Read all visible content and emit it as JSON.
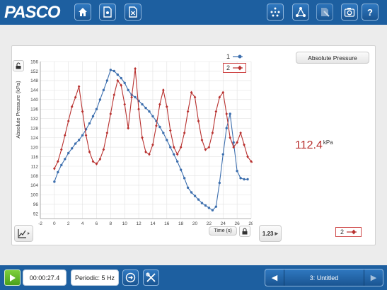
{
  "app": {
    "logo_text": "PASCO"
  },
  "toolbar": {
    "left_buttons": [
      "home-icon",
      "file-icon",
      "close-file-icon"
    ],
    "right_buttons": [
      "data-points-icon",
      "network-icon",
      "tools-icon",
      "camera-icon"
    ],
    "help_label": "?"
  },
  "graph": {
    "y_axis_label": "Absolute Pressure (kPa)",
    "x_axis_label": "Time (s)",
    "legend": [
      {
        "id": "1",
        "color": "#3d6fae"
      },
      {
        "id": "2",
        "color": "#b8312f"
      }
    ]
  },
  "chart_data": {
    "type": "line",
    "xlabel": "Time (s)",
    "ylabel": "Absolute Pressure (kPa)",
    "xlim": [
      -2,
      28
    ],
    "ylim": [
      90,
      156
    ],
    "x_ticks": [
      -2,
      0,
      2,
      4,
      6,
      8,
      10,
      12,
      14,
      16,
      18,
      20,
      22,
      24,
      26,
      28
    ],
    "y_ticks": [
      92,
      96,
      100,
      104,
      108,
      112,
      116,
      120,
      124,
      128,
      132,
      136,
      140,
      144,
      148,
      152,
      156
    ],
    "grid": true,
    "legend_position": "top-right",
    "series": [
      {
        "name": "1",
        "color": "#3d6fae",
        "points": [
          [
            0,
            105.5
          ],
          [
            0.5,
            109.5
          ],
          [
            1,
            112.5
          ],
          [
            1.5,
            115
          ],
          [
            2,
            117.5
          ],
          [
            2.5,
            119.5
          ],
          [
            3,
            121.5
          ],
          [
            3.5,
            123
          ],
          [
            4,
            125
          ],
          [
            4.5,
            127.5
          ],
          [
            5,
            130
          ],
          [
            5.5,
            133
          ],
          [
            6,
            136
          ],
          [
            6.5,
            140
          ],
          [
            7,
            144
          ],
          [
            7.5,
            148
          ],
          [
            8,
            152.5
          ],
          [
            8.5,
            152
          ],
          [
            9,
            150.5
          ],
          [
            9.5,
            149
          ],
          [
            10,
            147
          ],
          [
            10.5,
            144
          ],
          [
            11,
            142
          ],
          [
            11.5,
            141
          ],
          [
            12,
            139.5
          ],
          [
            12.5,
            138
          ],
          [
            13,
            136.5
          ],
          [
            13.5,
            135
          ],
          [
            14,
            133
          ],
          [
            14.5,
            131
          ],
          [
            15,
            128.5
          ],
          [
            15.5,
            126
          ],
          [
            16,
            123
          ],
          [
            16.5,
            120
          ],
          [
            17,
            117
          ],
          [
            17.5,
            114
          ],
          [
            18,
            110.5
          ],
          [
            18.5,
            107
          ],
          [
            19,
            103
          ],
          [
            19.5,
            101
          ],
          [
            20,
            99.5
          ],
          [
            20.5,
            98
          ],
          [
            21,
            96.5
          ],
          [
            21.5,
            95.5
          ],
          [
            22,
            94.5
          ],
          [
            22.5,
            93.5
          ],
          [
            23,
            95
          ],
          [
            23.5,
            105
          ],
          [
            24,
            117
          ],
          [
            24.5,
            128
          ],
          [
            25,
            134
          ],
          [
            25.5,
            122
          ],
          [
            26,
            110
          ],
          [
            26.5,
            107
          ],
          [
            27,
            106.5
          ],
          [
            27.5,
            106.5
          ]
        ]
      },
      {
        "name": "2",
        "color": "#b8312f",
        "points": [
          [
            0,
            111
          ],
          [
            0.5,
            114
          ],
          [
            1,
            119
          ],
          [
            1.5,
            125
          ],
          [
            2,
            131
          ],
          [
            2.5,
            137
          ],
          [
            3,
            141
          ],
          [
            3.5,
            145.5
          ],
          [
            4,
            135
          ],
          [
            4.5,
            125
          ],
          [
            5,
            118
          ],
          [
            5.5,
            114
          ],
          [
            6,
            113
          ],
          [
            6.5,
            115
          ],
          [
            7,
            119
          ],
          [
            7.5,
            126
          ],
          [
            8,
            134
          ],
          [
            8.5,
            142
          ],
          [
            9,
            148
          ],
          [
            9.5,
            146
          ],
          [
            10,
            138
          ],
          [
            10.5,
            128
          ],
          [
            11,
            141
          ],
          [
            11.5,
            153
          ],
          [
            12,
            136
          ],
          [
            12.5,
            124
          ],
          [
            13,
            118
          ],
          [
            13.5,
            117
          ],
          [
            14,
            121
          ],
          [
            14.5,
            129
          ],
          [
            15,
            138
          ],
          [
            15.5,
            144
          ],
          [
            16,
            137
          ],
          [
            16.5,
            127
          ],
          [
            17,
            120
          ],
          [
            17.5,
            117
          ],
          [
            18,
            120
          ],
          [
            18.5,
            126
          ],
          [
            19,
            135
          ],
          [
            19.5,
            143
          ],
          [
            20,
            141
          ],
          [
            20.5,
            131
          ],
          [
            21,
            123
          ],
          [
            21.5,
            119
          ],
          [
            22,
            120
          ],
          [
            22.5,
            126
          ],
          [
            23,
            135
          ],
          [
            23.5,
            141
          ],
          [
            24,
            143
          ],
          [
            24.5,
            134
          ],
          [
            25,
            124
          ],
          [
            25.5,
            120
          ],
          [
            26,
            122
          ],
          [
            26.5,
            126
          ],
          [
            27,
            121
          ],
          [
            27.5,
            116
          ],
          [
            28,
            114
          ],
          [
            28.5,
            113
          ],
          [
            29,
            112
          ]
        ]
      }
    ]
  },
  "digits_display": {
    "title": "Absolute Pressure",
    "value": "112.4",
    "unit": "kPa",
    "series_chip": "2",
    "series_color": "#b8312f"
  },
  "controls": {
    "digits_button": "1.23",
    "graph_tools_icon": "graph-icon",
    "time_axis_label": "Time (s)"
  },
  "bottom": {
    "elapsed_time": "00:00:27.4",
    "sampling": "Periodic: 5 Hz",
    "page_title": "3: Untitled",
    "prev": "◀",
    "next": "▶"
  }
}
